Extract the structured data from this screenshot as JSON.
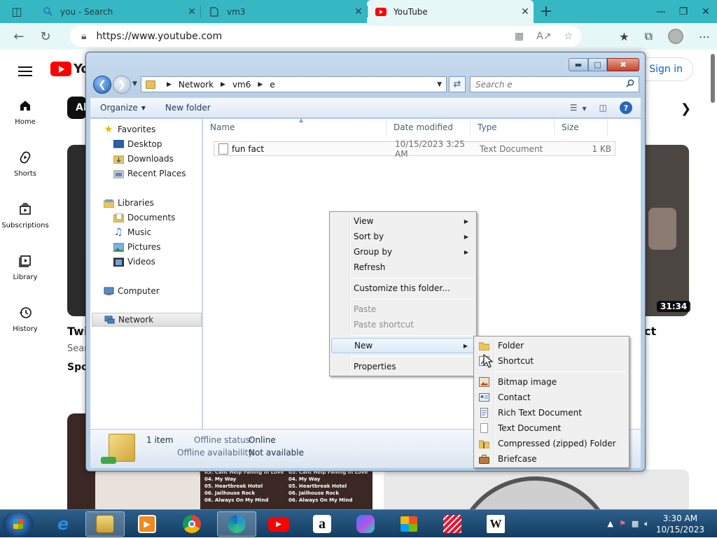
{
  "browser": {
    "tabs": [
      {
        "title": "you - Search",
        "icon": "search-icon"
      },
      {
        "title": "vm3",
        "icon": "document-icon"
      },
      {
        "title": "YouTube",
        "icon": "youtube-icon",
        "active": true
      }
    ],
    "url": "https://www.youtube.com"
  },
  "youtube": {
    "logo_text": "Yo",
    "sign_in": "Sign in",
    "chip": "All",
    "sidebar": [
      {
        "label": "Home",
        "icon": "home-icon"
      },
      {
        "label": "Shorts",
        "icon": "shorts-icon"
      },
      {
        "label": "Subscriptions",
        "icon": "subscriptions-icon"
      },
      {
        "label": "Library",
        "icon": "library-icon"
      },
      {
        "label": "History",
        "icon": "history-icon"
      }
    ],
    "video_left": {
      "title_fragment": "Twi",
      "channel_fragment": "Sear",
      "meta_fragment": "Spo"
    },
    "video_right": {
      "title_fragment": "ct",
      "duration": "31:34"
    },
    "tracks": [
      "03. Cant Help Falling In Love",
      "03. Cant Help Falling In Love",
      "04. My Way",
      "04. My Way",
      "05. Heartbreak Hotel",
      "05. Heartbreak Hotel",
      "06. Jailhouse Rock",
      "06. Jailhouse Rock",
      "06. Always On My Mind",
      "06. Always On My Mind"
    ]
  },
  "explorer": {
    "breadcrumb": [
      "Network",
      "vm6",
      "e"
    ],
    "search_placeholder": "Search e",
    "toolbar": {
      "organize": "Organize",
      "new_folder": "New folder"
    },
    "nav": {
      "favorites": "Favorites",
      "desktop": "Desktop",
      "downloads": "Downloads",
      "recent": "Recent Places",
      "libraries": "Libraries",
      "documents": "Documents",
      "music": "Music",
      "pictures": "Pictures",
      "videos": "Videos",
      "computer": "Computer",
      "network": "Network"
    },
    "columns": [
      "Name",
      "Date modified",
      "Type",
      "Size"
    ],
    "files": [
      {
        "name": "fun fact",
        "date": "10/15/2023 3:25 AM",
        "type": "Text Document",
        "size": "1 KB"
      }
    ],
    "details": {
      "count": "1 item",
      "offline_status_label": "Offline status:",
      "offline_status": "Online",
      "offline_avail_label": "Offline availability:",
      "offline_avail": "Not available"
    }
  },
  "context_menu": {
    "view": "View",
    "sort_by": "Sort by",
    "group_by": "Group by",
    "refresh": "Refresh",
    "customize": "Customize this folder...",
    "paste": "Paste",
    "paste_shortcut": "Paste shortcut",
    "new": "New",
    "properties": "Properties"
  },
  "new_submenu": {
    "folder": "Folder",
    "shortcut": "Shortcut",
    "bitmap": "Bitmap image",
    "contact": "Contact",
    "rtf": "Rich Text Document",
    "text": "Text Document",
    "zip": "Compressed (zipped) Folder",
    "briefcase": "Briefcase"
  },
  "taskbar": {
    "time": "3:30 AM",
    "date": "10/15/2023",
    "amazon_glyph": "a",
    "wikipedia_glyph": "W"
  }
}
